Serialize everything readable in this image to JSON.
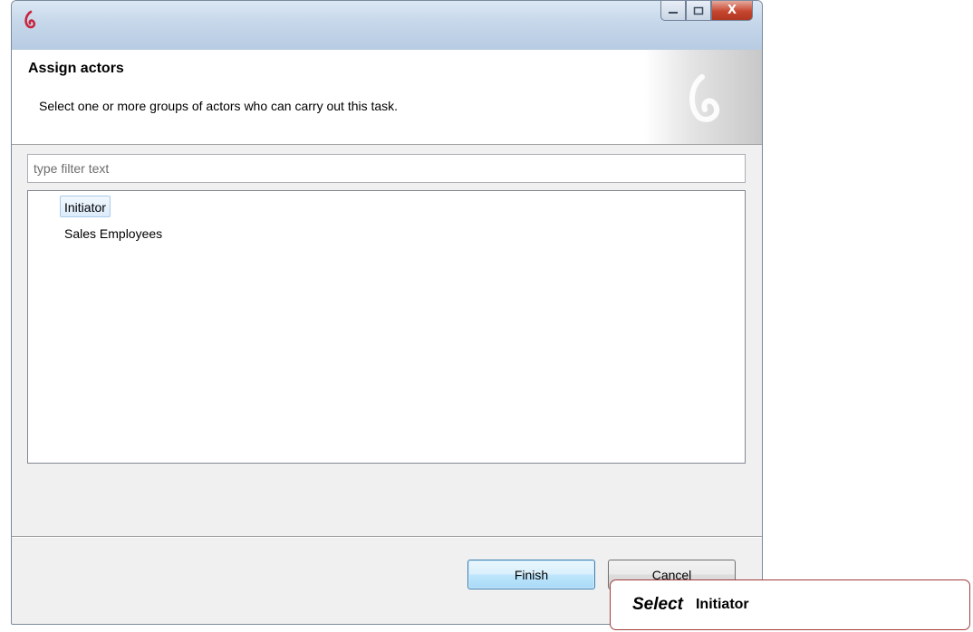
{
  "window": {
    "controls": {
      "close_label": "X"
    }
  },
  "header": {
    "title": "Assign actors",
    "description": "Select one or more groups of actors who can carry out this task."
  },
  "filter": {
    "placeholder": "type filter text",
    "value": ""
  },
  "actors": {
    "items": [
      {
        "label": "Initiator",
        "selected": true
      },
      {
        "label": "Sales Employees",
        "selected": false
      }
    ]
  },
  "buttons": {
    "finish": "Finish",
    "cancel": "Cancel"
  },
  "callout": {
    "verb": "Select",
    "target": "Initiator"
  },
  "colors": {
    "accent_logo": "#c8243c",
    "selection_border": "#a9cbea",
    "callout_border": "#a33b3b"
  }
}
